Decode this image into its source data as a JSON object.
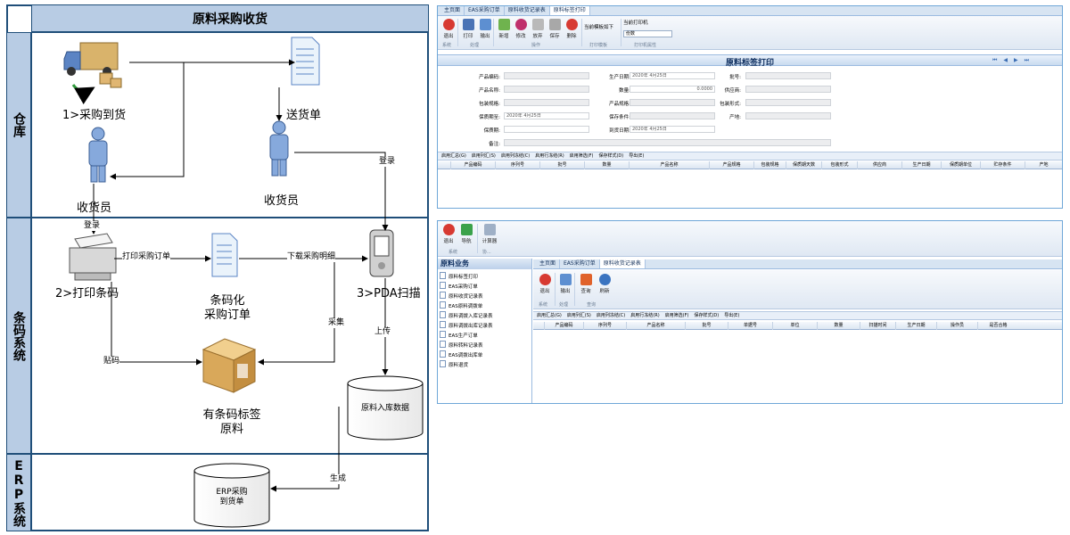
{
  "diagram": {
    "title": "原料采购收货",
    "lanes": [
      "仓库",
      "条码系统",
      "ERP系统"
    ],
    "nodes": {
      "arrive": "1>采购到货",
      "delivery_note": "送货单",
      "receiver_left": "收货员",
      "receiver_right": "收货员",
      "print_barcode": "2>打印条码",
      "barcode_order": "条码化\n采购订单",
      "pda_scan": "3>PDA扫描",
      "labeled_material": "有条码标签\n原料",
      "material_db": "原料入库数据",
      "erp_db": "ERP采购\n到货单"
    },
    "edge_labels": {
      "login_top": "登录",
      "login_left": "登录",
      "print_order": "打印采购订单",
      "download_detail": "下载采购明细",
      "stick": "贴码",
      "collect": "采集",
      "upload": "上传",
      "generate": "生成"
    }
  },
  "window1": {
    "tabs": [
      "主页面",
      "EAS采购订单",
      "原料收货记录表",
      "原料标签打印"
    ],
    "active_tab": 3,
    "ribbon": {
      "buttons": [
        "退出",
        "打印",
        "输出",
        "新增",
        "修改",
        "放弃",
        "保存",
        "删除"
      ],
      "groups": [
        "系统",
        "处理",
        "操作",
        "打印模板",
        "打印机属性"
      ],
      "template_label": "当前模板如下",
      "printer_label": "当前打印机",
      "printer_value": "份数"
    },
    "form_title": "原料标签打印",
    "nav_arrows": [
      "⏮",
      "◀",
      "▶",
      "⏭"
    ],
    "fields": [
      {
        "label": "产品编码:",
        "value": ""
      },
      {
        "label": "生产日期:",
        "value": "2020年  4月25日"
      },
      {
        "label": "批号:",
        "value": ""
      },
      {
        "label": "产品名称:",
        "value": ""
      },
      {
        "label": "数量:",
        "value": "0.0000"
      },
      {
        "label": "供应商:",
        "value": ""
      },
      {
        "label": "包装规格:",
        "value": ""
      },
      {
        "label": "产品规格:",
        "value": ""
      },
      {
        "label": "包装形式:",
        "value": ""
      },
      {
        "label": "保质期至:",
        "value": "2020年  4月25日"
      },
      {
        "label": "保存条件:",
        "value": ""
      },
      {
        "label": "产地:",
        "value": ""
      },
      {
        "label": "保质期:",
        "value": ""
      },
      {
        "label": "到货日期:",
        "value": "2020年  4月25日"
      },
      {
        "label": "备注:",
        "value": ""
      }
    ],
    "toolbar": [
      "启用汇总(G)",
      "启用列汇(S)",
      "启用列冻结(C)",
      "启用行冻结(R)",
      "启用筛选(F)",
      "保存样式(D)",
      "导出(E)"
    ],
    "columns": [
      "产品编码",
      "序列号",
      "批号",
      "数量",
      "产品名称",
      "产品规格",
      "包装规格",
      "保质期天数",
      "包装形式",
      "供应商",
      "生产日期",
      "保质期单位",
      "贮存条件",
      "产地"
    ]
  },
  "window2": {
    "ribbon": {
      "buttons": [
        "退出",
        "导航",
        "计算器"
      ],
      "groups": [
        "系统",
        "协..."
      ]
    },
    "sidebar_title": "原料业务",
    "sidebar_items": [
      "原料标签打印",
      "EAS采购订单",
      "原料收货记录表",
      "EAS原料调拨单",
      "原料调拨入库记录表",
      "原料调拨出库记录表",
      "EAS生产订单",
      "原料转料记录表",
      "EAS调拨出库单",
      "原料退货"
    ],
    "tabs": [
      "主页面",
      "EAS采购订单",
      "原料收货记录表"
    ],
    "active_tab": 2,
    "inner_buttons": [
      "退出",
      "输出",
      "查询",
      "刷新"
    ],
    "inner_groups": [
      "系统",
      "处理",
      "查询"
    ],
    "toolbar": [
      "启用汇总(G)",
      "启用列汇(S)",
      "启用列冻结(C)",
      "启用行冻结(R)",
      "启用筛选(F)",
      "保存样式(D)",
      "导出(E)"
    ],
    "columns": [
      "产品编码",
      "序列号",
      "产品名称",
      "批号",
      "单据号",
      "单位",
      "数量",
      "扫描时间",
      "生产日期",
      "操作员",
      "是否合格"
    ]
  },
  "colors": {
    "lane_header": "#b8cce4",
    "border": "#1f4e79",
    "ribbon_blue": "#d7e4f2",
    "exit_red": "#d73a32"
  }
}
